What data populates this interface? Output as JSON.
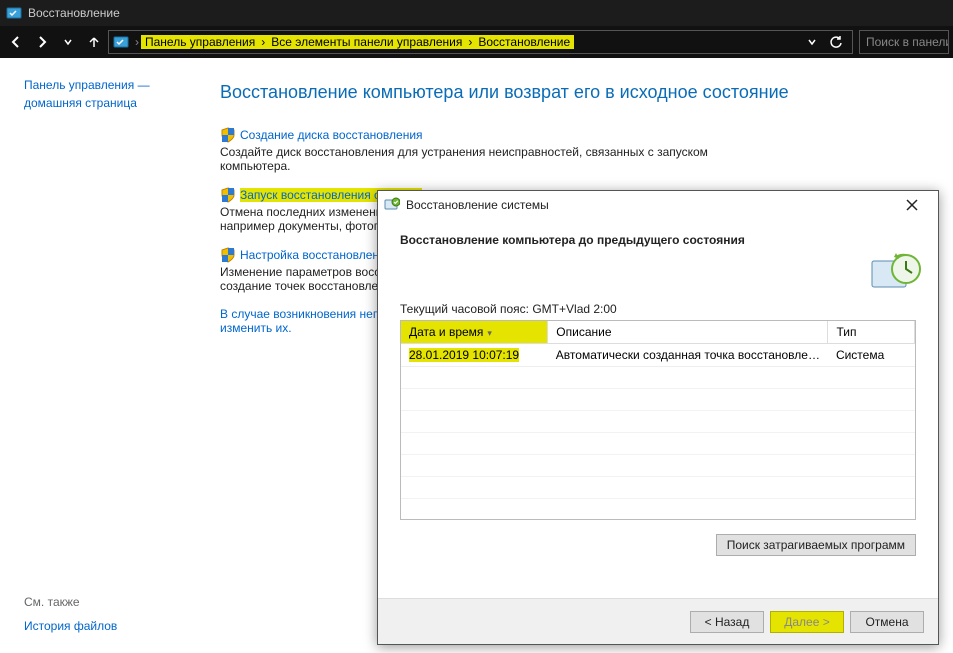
{
  "window": {
    "title": "Восстановление"
  },
  "breadcrumb": {
    "root_label": "Панель управления",
    "mid_label": "Все элементы панели управления",
    "leaf_label": "Восстановление",
    "search_placeholder": "Поиск в панели"
  },
  "sidebar": {
    "home_line1": "Панель управления —",
    "home_line2": "домашняя страница",
    "see_also_header": "См. также",
    "file_history": "История файлов"
  },
  "main": {
    "heading": "Восстановление компьютера или возврат его в исходное состояние",
    "opt1": {
      "link": "Создание диска восстановления",
      "desc": "Создайте диск восстановления для устранения неисправностей, связанных с запуском компьютера."
    },
    "opt2": {
      "link": "Запуск восстановления системы",
      "desc": "Отмена последних изменений системы, которые могли вызвать проблемы. Ваши файлы, например документы, фотографии и музыка, остаются без изменений."
    },
    "opt3": {
      "link": "Настройка восстановления системы",
      "desc": "Изменение параметров восстановления, управление дисковым пространством и удаление или создание точек восстановления."
    },
    "note": "В случае возникновения неполадок на компьютере, перейдите к его параметрам и попробуйте изменить их."
  },
  "dialog": {
    "title": "Восстановление системы",
    "heading": "Восстановление компьютера до предыдущего состояния",
    "timezone": "Текущий часовой пояс: GMT+Vlad 2:00",
    "columns": {
      "date": "Дата и время",
      "desc": "Описание",
      "type": "Тип"
    },
    "row": {
      "date": "28.01.2019 10:07:19",
      "desc": "Автоматически созданная точка восстановле…",
      "type": "Система"
    },
    "affected_button": "Поиск затрагиваемых программ",
    "back": "< Назад",
    "next": "Далее >",
    "cancel": "Отмена"
  }
}
